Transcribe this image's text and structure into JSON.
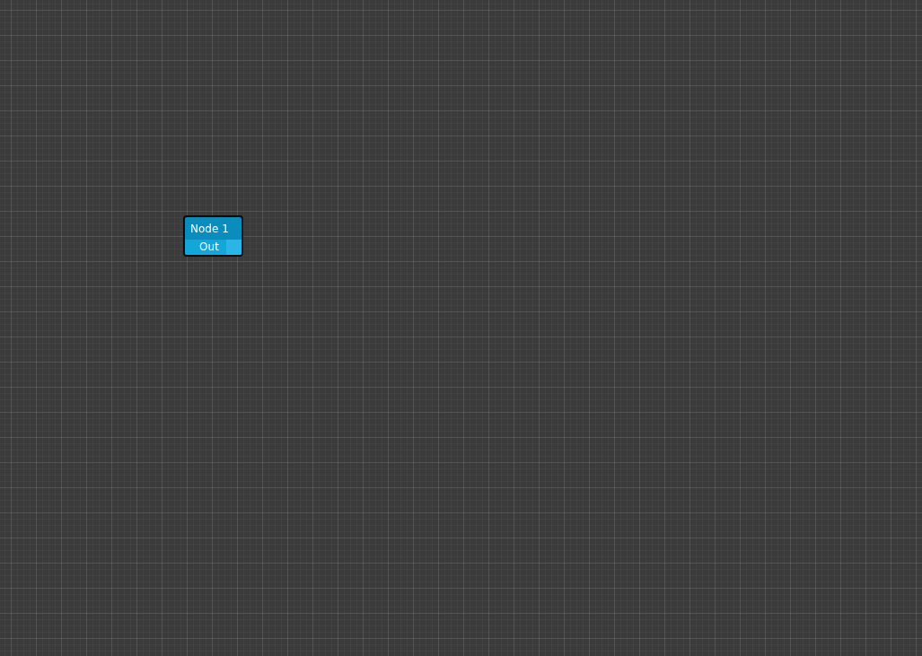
{
  "nodes": [
    {
      "title": "Node 1",
      "ports": [
        {
          "label": "Out",
          "kind": "output"
        }
      ]
    }
  ]
}
